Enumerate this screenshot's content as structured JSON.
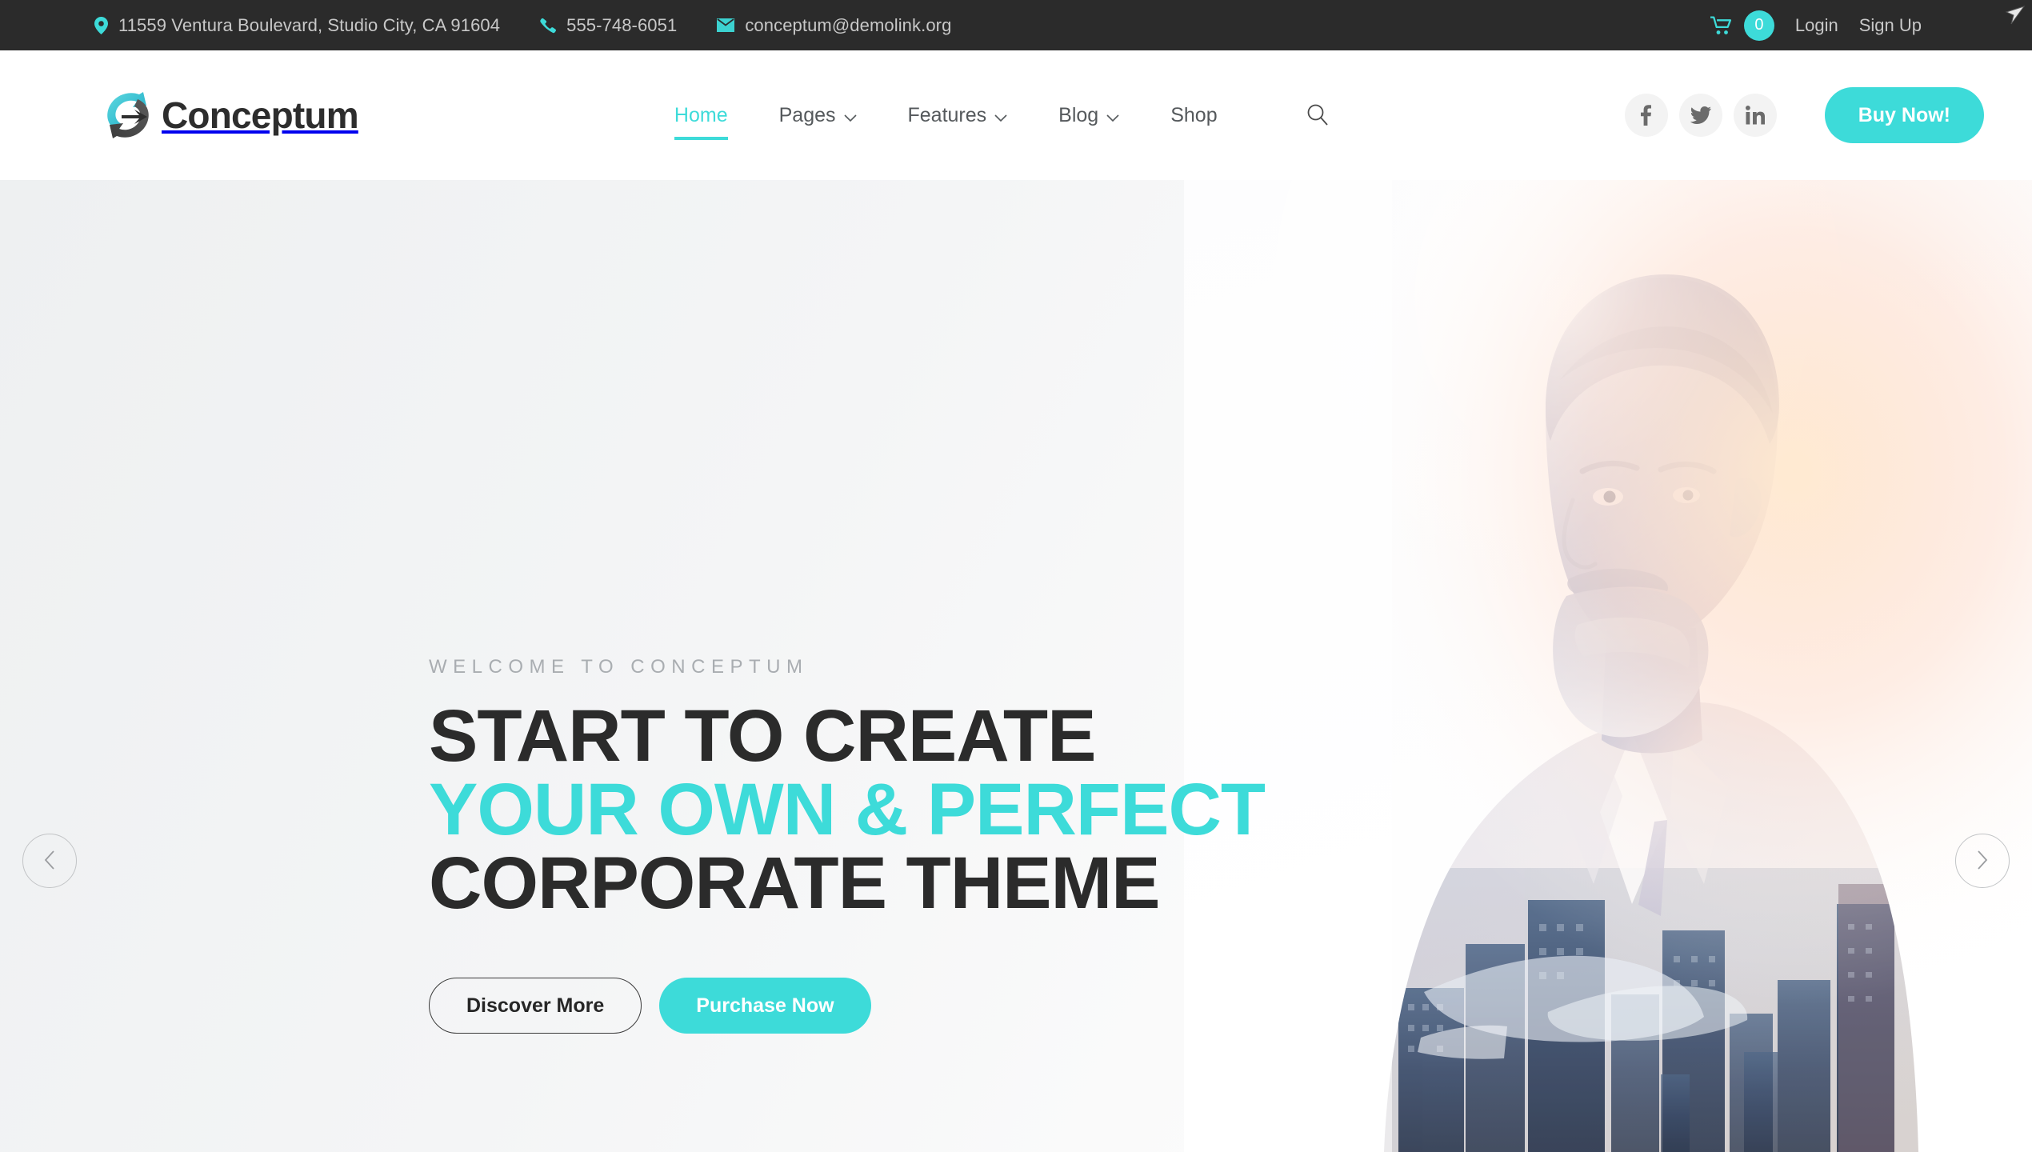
{
  "topbar": {
    "address": "11559 Ventura Boulevard, Studio City, CA 91604",
    "phone": "555-748-6051",
    "email": "conceptum@demolink.org",
    "cart_count": "0",
    "login_label": "Login",
    "signup_label": "Sign Up",
    "bg_color": "#2b2b2b",
    "accent_color": "#3ddbd9"
  },
  "header": {
    "brand_name": "Conceptum",
    "nav": [
      {
        "label": "Home",
        "has_dropdown": false,
        "active": true
      },
      {
        "label": "Pages",
        "has_dropdown": true,
        "active": false
      },
      {
        "label": "Features",
        "has_dropdown": true,
        "active": false
      },
      {
        "label": "Blog",
        "has_dropdown": true,
        "active": false
      },
      {
        "label": "Shop",
        "has_dropdown": false,
        "active": false
      }
    ],
    "social": [
      {
        "name": "facebook",
        "glyph": "f"
      },
      {
        "name": "twitter",
        "glyph": "t"
      },
      {
        "name": "linkedin",
        "glyph": "in"
      }
    ],
    "buy_label": "Buy Now!",
    "accent_color": "#3ddbd9"
  },
  "hero": {
    "eyebrow": "WELCOME TO CONCEPTUM",
    "headline_line1": "START TO CREATE",
    "headline_line2": "YOUR OWN & PERFECT",
    "headline_line3": "CORPORATE THEME",
    "primary_cta": "Purchase Now",
    "secondary_cta": "Discover More",
    "headline_color": "#2b2b2b",
    "highlight_color": "#3ddbd9",
    "image_description": "Double-exposure portrait of bearded businessman blended with blue city skyline"
  }
}
